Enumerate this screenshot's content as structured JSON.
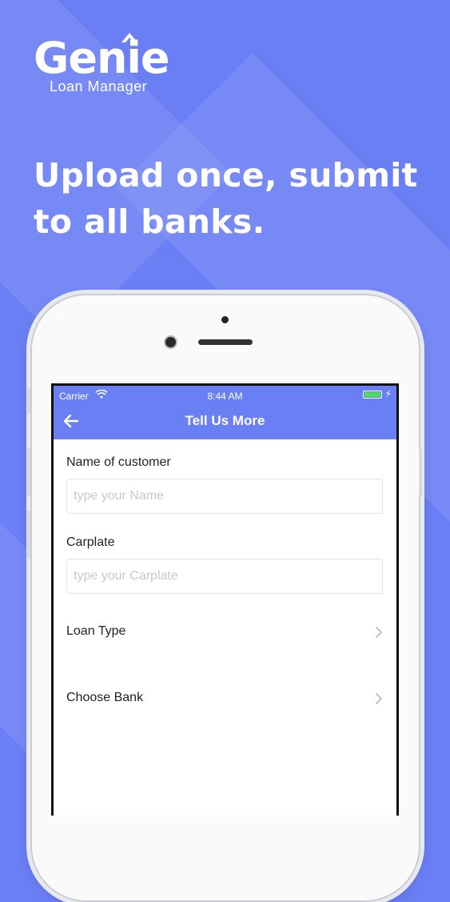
{
  "brand": {
    "logo_text": "Genie",
    "logo_subtitle": "Loan Manager"
  },
  "headline": "Upload once, submit to all banks.",
  "status_bar": {
    "carrier": "Carrier",
    "time": "8:44 AM"
  },
  "screen": {
    "title": "Tell Us More",
    "fields": [
      {
        "label": "Name of customer",
        "placeholder": "type your Name"
      },
      {
        "label": "Carplate",
        "placeholder": "type your Carplate"
      }
    ],
    "rows": [
      {
        "label": "Loan Type"
      },
      {
        "label": "Choose Bank"
      }
    ]
  },
  "colors": {
    "brand_blue": "#6b7ff5",
    "battery_green": "#4cd964"
  },
  "icons": [
    "back-arrow-icon",
    "wifi-icon",
    "battery-icon",
    "chevron-right-icon"
  ]
}
